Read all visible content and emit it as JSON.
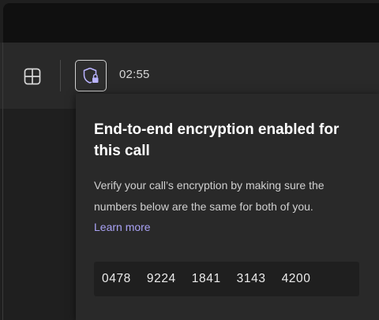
{
  "toolbar": {
    "gallery_icon": "gallery-grid-icon",
    "encryption_icon": "shield-lock-icon",
    "timer": "02:55"
  },
  "popover": {
    "title": "End-to-end encryption enabled for this call",
    "description": "Verify your call’s encryption by making sure the numbers below are the same for both of you.",
    "learn_more": "Learn more",
    "codes": [
      "0478",
      "9224",
      "1841",
      "3143",
      "4200"
    ]
  },
  "colors": {
    "background": "#1f1f1f",
    "panel": "#292929",
    "link": "#a9a2f5",
    "shield_accent": "#b9b3ff"
  }
}
